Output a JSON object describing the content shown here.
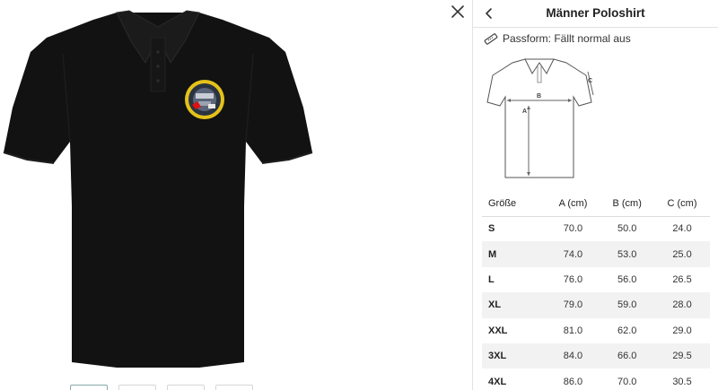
{
  "panel": {
    "title": "Männer Poloshirt",
    "fit_label": "Passform: Fällt normal aus"
  },
  "diagram": {
    "labels": [
      "A",
      "B",
      "C"
    ]
  },
  "size_table": {
    "headers": [
      "Größe",
      "A (cm)",
      "B (cm)",
      "C (cm)"
    ],
    "rows": [
      [
        "S",
        "70.0",
        "50.0",
        "24.0"
      ],
      [
        "M",
        "74.0",
        "53.0",
        "25.0"
      ],
      [
        "L",
        "76.0",
        "56.0",
        "26.5"
      ],
      [
        "XL",
        "79.0",
        "59.0",
        "28.0"
      ],
      [
        "XXL",
        "81.0",
        "62.0",
        "29.0"
      ],
      [
        "3XL",
        "84.0",
        "66.0",
        "29.5"
      ],
      [
        "4XL",
        "86.0",
        "70.0",
        "30.5"
      ]
    ]
  },
  "icons": {
    "close": "close-icon",
    "back": "chevron-left-icon",
    "ruler": "ruler-icon"
  },
  "colors": {
    "shirt": "#121212",
    "logo_ring": "#e4c21a",
    "row_alt": "#f2f2f2"
  }
}
